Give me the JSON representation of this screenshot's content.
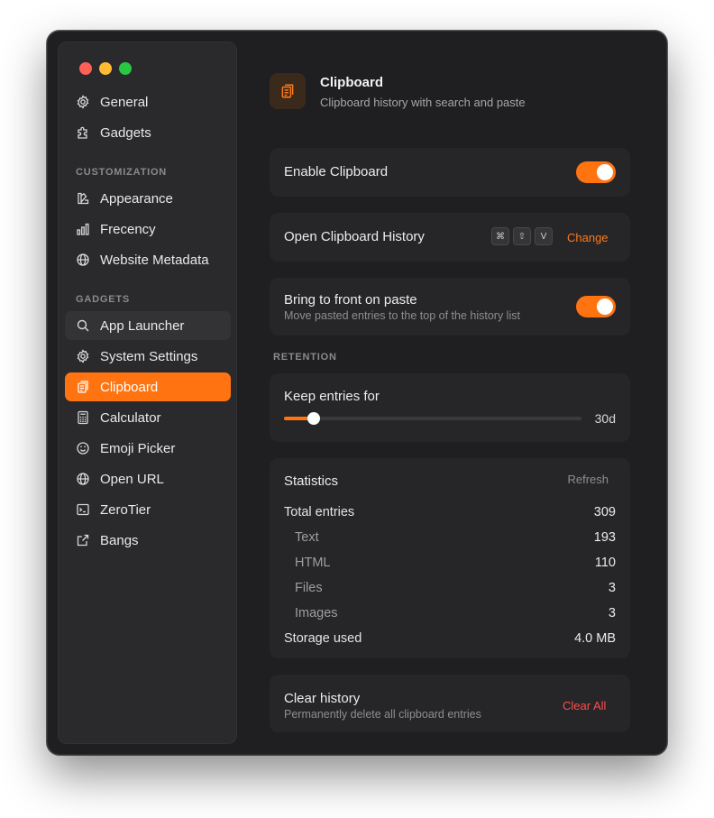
{
  "sidebar": {
    "top_items": [
      {
        "label": "General",
        "icon": "gear-icon"
      },
      {
        "label": "Gadgets",
        "icon": "puzzle-icon"
      }
    ],
    "customization_label": "CUSTOMIZATION",
    "customization_items": [
      {
        "label": "Appearance",
        "icon": "appearance-icon"
      },
      {
        "label": "Frecency",
        "icon": "bar-chart-icon"
      },
      {
        "label": "Website Metadata",
        "icon": "globe-icon"
      }
    ],
    "gadgets_label": "GADGETS",
    "gadget_items": [
      {
        "label": "App Launcher",
        "icon": "search-icon"
      },
      {
        "label": "System Settings",
        "icon": "gear-icon"
      },
      {
        "label": "Clipboard",
        "icon": "clipboard-icon",
        "active": true
      },
      {
        "label": "Calculator",
        "icon": "calculator-icon"
      },
      {
        "label": "Emoji Picker",
        "icon": "smiley-icon"
      },
      {
        "label": "Open URL",
        "icon": "globe-icon"
      },
      {
        "label": "ZeroTier",
        "icon": "terminal-icon"
      },
      {
        "label": "Bangs",
        "icon": "external-link-icon"
      }
    ]
  },
  "header": {
    "title": "Clipboard",
    "subtitle": "Clipboard history with search and paste",
    "icon": "clipboard-icon"
  },
  "settings": {
    "enable_label": "Enable Clipboard",
    "enable_on": true,
    "open_history_label": "Open Clipboard History",
    "shortcut_keys": [
      "⌘",
      "⇧",
      "V"
    ],
    "change_label": "Change",
    "bring_front_label": "Bring to front on paste",
    "bring_front_desc": "Move pasted entries to the top of the history list",
    "bring_front_on": true
  },
  "retention": {
    "section_label": "RETENTION",
    "keep_label": "Keep entries for",
    "slider_fraction": 0.1,
    "value": "30d"
  },
  "statistics": {
    "title": "Statistics",
    "refresh_label": "Refresh",
    "rows": [
      {
        "label": "Total entries",
        "value": "309",
        "sub": false
      },
      {
        "label": "Text",
        "value": "193",
        "sub": true
      },
      {
        "label": "HTML",
        "value": "110",
        "sub": true
      },
      {
        "label": "Files",
        "value": "3",
        "sub": true
      },
      {
        "label": "Images",
        "value": "3",
        "sub": true
      },
      {
        "label": "Storage used",
        "value": "4.0 MB",
        "sub": false
      }
    ]
  },
  "clear": {
    "label": "Clear history",
    "desc": "Permanently delete all clipboard entries",
    "button_label": "Clear All"
  },
  "colors": {
    "accent": "#ff7410",
    "danger": "#ff4d4d"
  }
}
